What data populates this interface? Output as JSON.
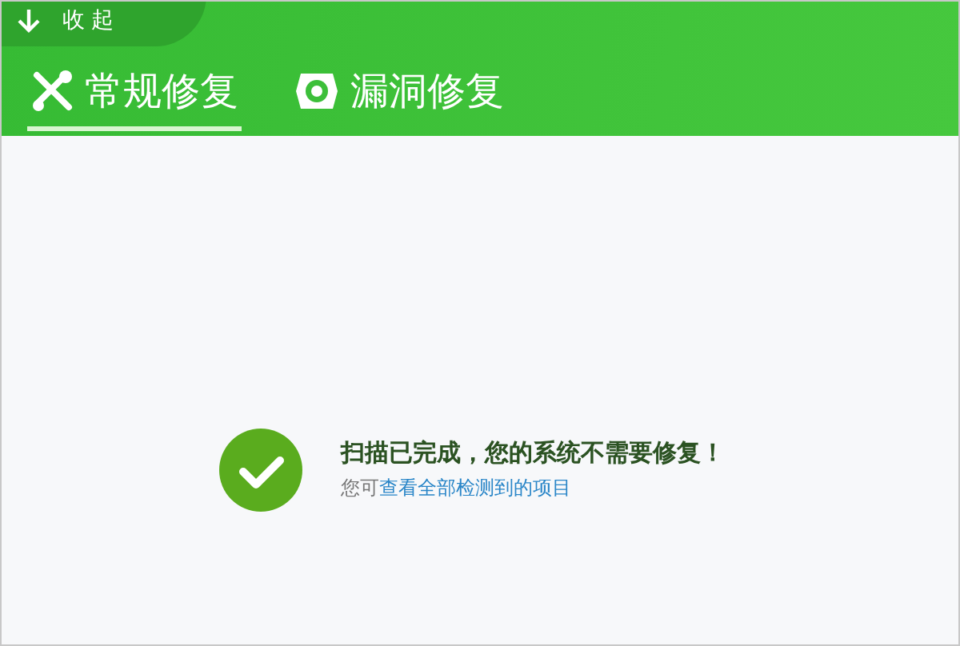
{
  "collapse_button": {
    "label": "收起"
  },
  "tabs": [
    {
      "label": "常规修复",
      "selected": true
    },
    {
      "label": "漏洞修复",
      "selected": false
    }
  ],
  "result": {
    "title": "扫描已完成，您的系统不需要修复！",
    "note": "您可",
    "link": "查看全部检测到的项目"
  }
}
